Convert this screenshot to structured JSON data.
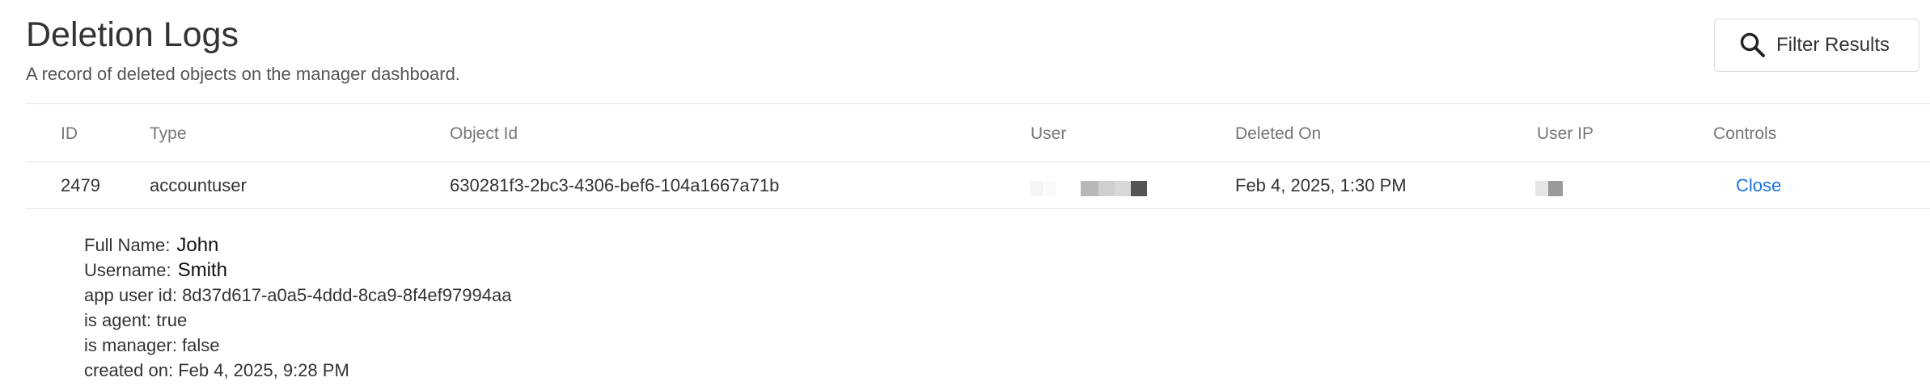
{
  "header": {
    "title": "Deletion Logs",
    "subtitle": "A record of deleted objects on the manager dashboard."
  },
  "toolbar": {
    "filter_label": "Filter Results",
    "filter_icon": "search-icon"
  },
  "table": {
    "columns": [
      "ID",
      "Type",
      "Object Id",
      "User",
      "Deleted On",
      "User IP",
      "Controls"
    ],
    "rows": [
      {
        "id": "2479",
        "type": "accountuser",
        "object_id": "630281f3-2bc3-4306-bef6-104a1667a71b",
        "user": "",
        "deleted_on": "Feb 4, 2025, 1:30 PM",
        "user_ip": "",
        "control_label": "Close"
      }
    ]
  },
  "details": {
    "full_name_label": "Full Name:",
    "full_name_value": "John",
    "username_label": "Username:",
    "username_value": "Smith",
    "app_user_id": "app user id: 8d37d617-a0a5-4ddd-8ca9-8f4ef97994aa",
    "is_agent": "is agent: true",
    "is_manager": "is manager: false",
    "created_on": "created on: Feb 4, 2025, 9:28 PM"
  },
  "colors": {
    "accent_link": "#1a73e8",
    "divider": "#e3e3e3"
  }
}
